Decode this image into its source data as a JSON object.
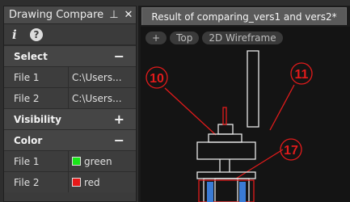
{
  "palette": {
    "title": "Drawing Compare",
    "pin_glyph": "⊥",
    "close_glyph": "✕",
    "toolbar": {
      "info_glyph": "i",
      "help_glyph": "?"
    },
    "sections": {
      "select": {
        "label": "Select",
        "toggle": "−"
      },
      "visibility": {
        "label": "Visibility",
        "toggle": "+"
      },
      "color": {
        "label": "Color",
        "toggle": "−"
      }
    },
    "select_rows": [
      {
        "key": "File 1",
        "value": "C:\\Users..."
      },
      {
        "key": "File 2",
        "value": "C:\\Users..."
      }
    ],
    "color_rows": [
      {
        "key": "File 1",
        "value": "green",
        "swatch": "#19e619"
      },
      {
        "key": "File 2",
        "value": "red",
        "swatch": "#e61919"
      }
    ]
  },
  "document": {
    "tab_title": "Result of comparing_vers1 and vers2*",
    "viewport_controls": {
      "zoom": "+",
      "view": "Top",
      "visual_style": "2D Wireframe"
    },
    "balloons": [
      "10",
      "11",
      "17"
    ],
    "colors": {
      "file2": "#e21b1b",
      "common": "#e8e8e8",
      "accent": "#3a7bd5"
    }
  }
}
